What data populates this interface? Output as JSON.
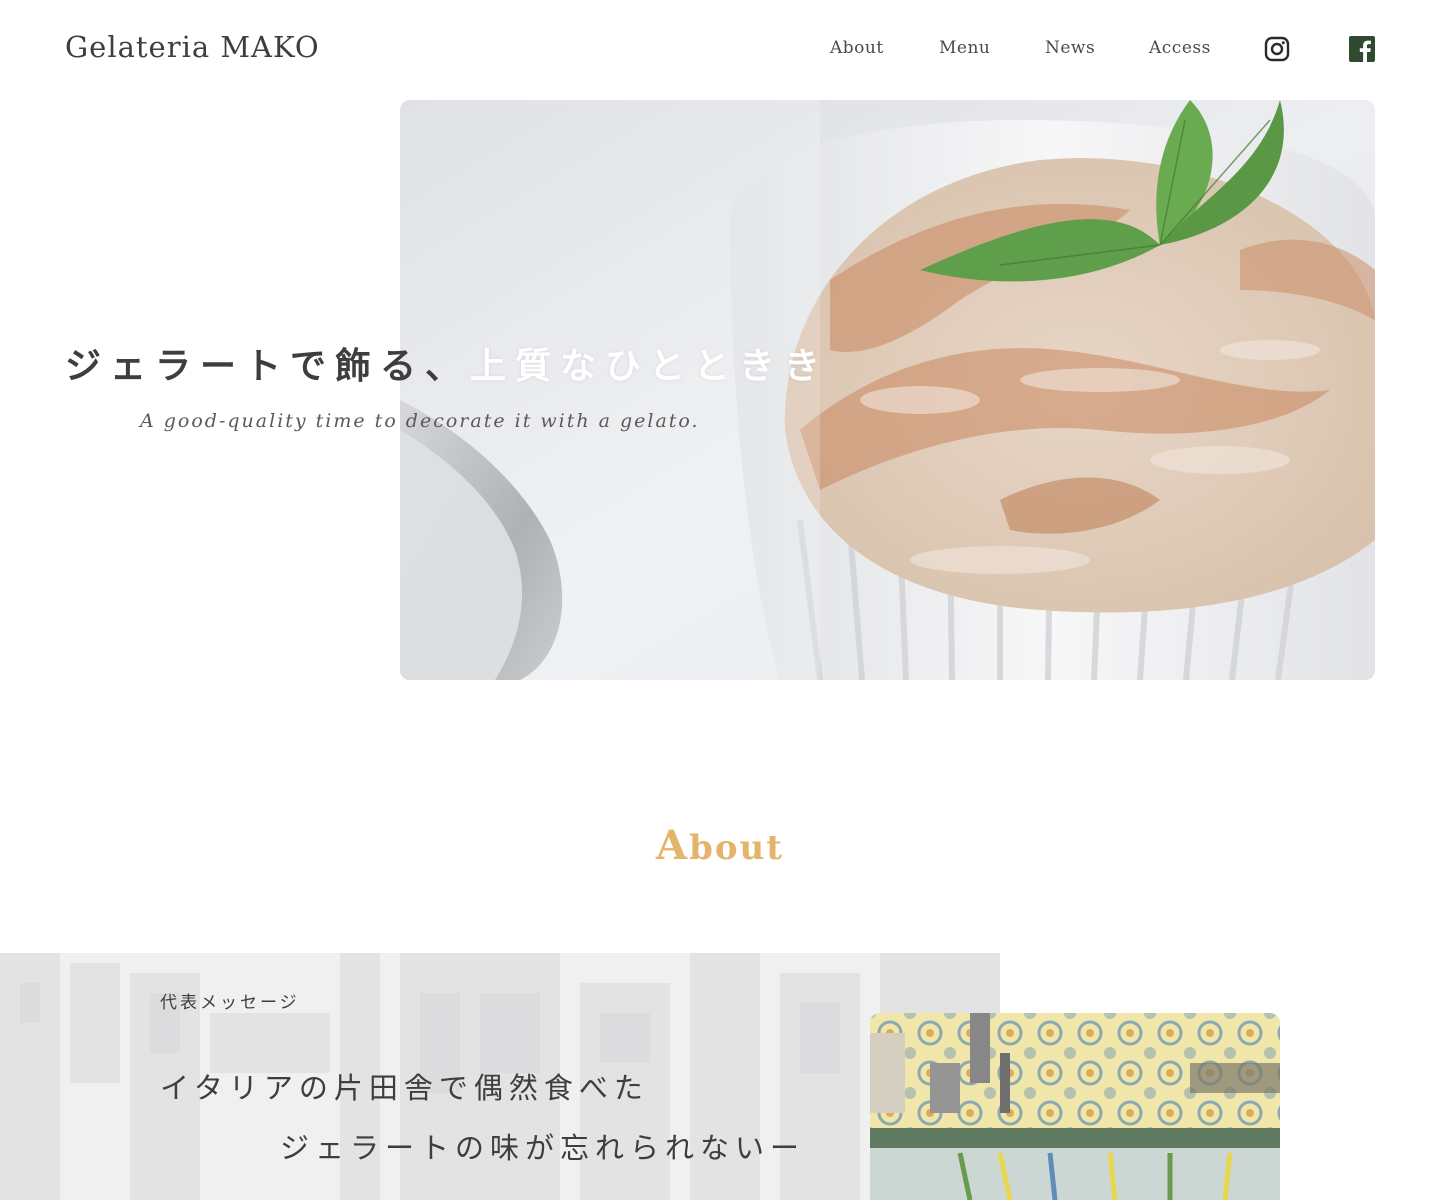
{
  "header": {
    "logo": "Gelateria MAKO",
    "nav": {
      "about": "About",
      "menu": "Menu",
      "news": "News",
      "access": "Access"
    },
    "social": [
      "instagram-icon",
      "facebook-icon"
    ]
  },
  "hero": {
    "title_part1": "ジェラートで飾る、",
    "title_part2": "上質なひとときき",
    "subtitle": "A good-quality time to decorate it with a gelato."
  },
  "about": {
    "heading_first": "A",
    "heading_rest": "bout",
    "label": "代表メッセージ",
    "line1": "イタリアの片田舎で偶然食べた",
    "line2": "ジェラートの味が忘れられないー"
  },
  "colors": {
    "accent": "#e3b46a",
    "text": "#3e3e3e",
    "facebook": "#2f4a2f"
  }
}
